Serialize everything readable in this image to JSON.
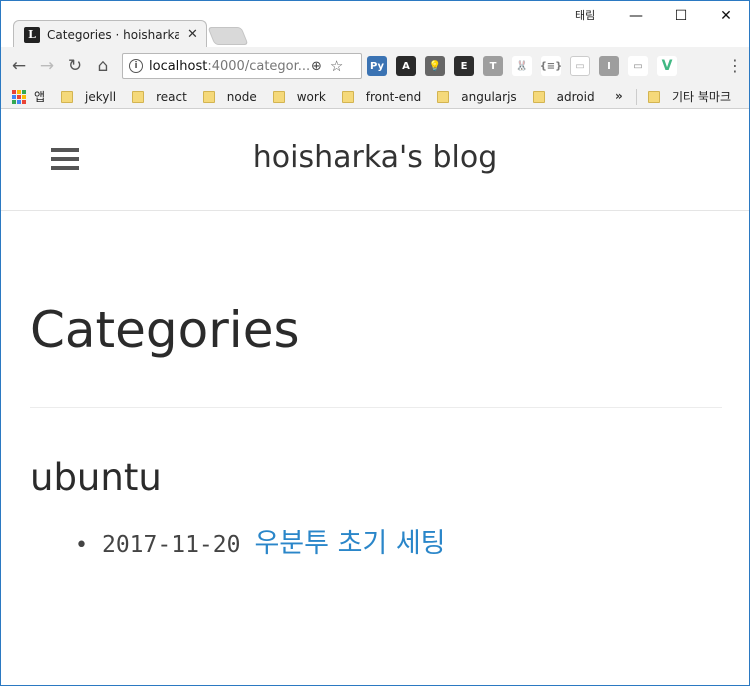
{
  "browser": {
    "tab_title": "Categories · hoisharka's",
    "tab_favicon": "L",
    "window_user": "태림",
    "url_host": "localhost",
    "url_path": ":4000/categor...",
    "extensions": [
      "python-icon",
      "translate-icon",
      "lightbulb-icon",
      "evernote-icon",
      "t-icon",
      "rabbit-icon",
      "json-icon",
      "dark-icon",
      "i-icon",
      "cast-icon",
      "vue-icon"
    ]
  },
  "bookmarks": {
    "apps_label": "앱",
    "folders": [
      "jekyll",
      "react",
      "node",
      "work",
      "front-end",
      "angularjs",
      "adroid"
    ],
    "overflow": "»",
    "other_label": "기타 북마크"
  },
  "site": {
    "title": "hoisharka's blog"
  },
  "page": {
    "heading": "Categories",
    "categories": [
      {
        "name": "ubuntu",
        "posts": [
          {
            "date": "2017-11-20",
            "title": "우분투 초기 세팅"
          }
        ]
      }
    ]
  },
  "colors": {
    "link": "#2a86c9",
    "window_border": "#2b79c2"
  }
}
